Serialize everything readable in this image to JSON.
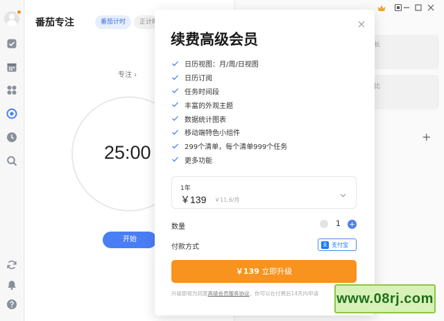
{
  "app": {
    "title": "番茄专注",
    "modes": [
      "番茄计时",
      "正计时"
    ]
  },
  "pomodoro": {
    "focus_label": "专注 ›",
    "timer": "25:00",
    "start_label": "开始"
  },
  "right_pane": {
    "card_texts": [
      "长",
      "比"
    ],
    "add_symbol": "+"
  },
  "modal": {
    "title": "续费高级会员",
    "close_icon": "close-icon",
    "features": [
      "日历视图：月/周/日视图",
      "日历订阅",
      "任务时间段",
      "丰富的外观主题",
      "数据统计图表",
      "移动端特色小组件",
      "299个清单，每个清单999个任务",
      "更多功能"
    ],
    "plan": {
      "label": "1年",
      "price": "￥139",
      "monthly": "￥11.6/月"
    },
    "quantity": {
      "label": "数量",
      "value": "1",
      "plus": "+"
    },
    "payment": {
      "label": "付款方式",
      "method": "支付宝",
      "icon_glyph": "支"
    },
    "buy": {
      "price": "￥139",
      "label": "立即升级"
    },
    "agreement": {
      "prefix": "升级即视为同意",
      "link": "高级会员服务协议",
      "suffix": "，你可以在付费后14天内申请"
    }
  },
  "watermark": {
    "text": "www.08rj.com"
  },
  "colors": {
    "accent": "#4a7ef4",
    "buy": "#f7931e",
    "crown": "#f2a532",
    "avatar_badge": "#f28c28"
  }
}
